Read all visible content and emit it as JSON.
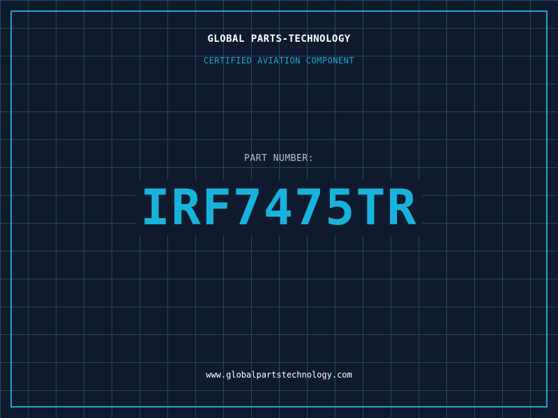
{
  "header": {
    "company_name": "GLOBAL PARTS-TECHNOLOGY",
    "tagline": "CERTIFIED AVIATION COMPONENT"
  },
  "part": {
    "label": "PART NUMBER:",
    "number": "IRF7475TR"
  },
  "footer": {
    "website": "www.globalpartstechnology.com"
  },
  "colors": {
    "background": "#101a2e",
    "grid": "#1f4a63",
    "accent": "#1aa8cf",
    "text_primary": "#ffffff",
    "text_muted": "#b7c0cc"
  }
}
